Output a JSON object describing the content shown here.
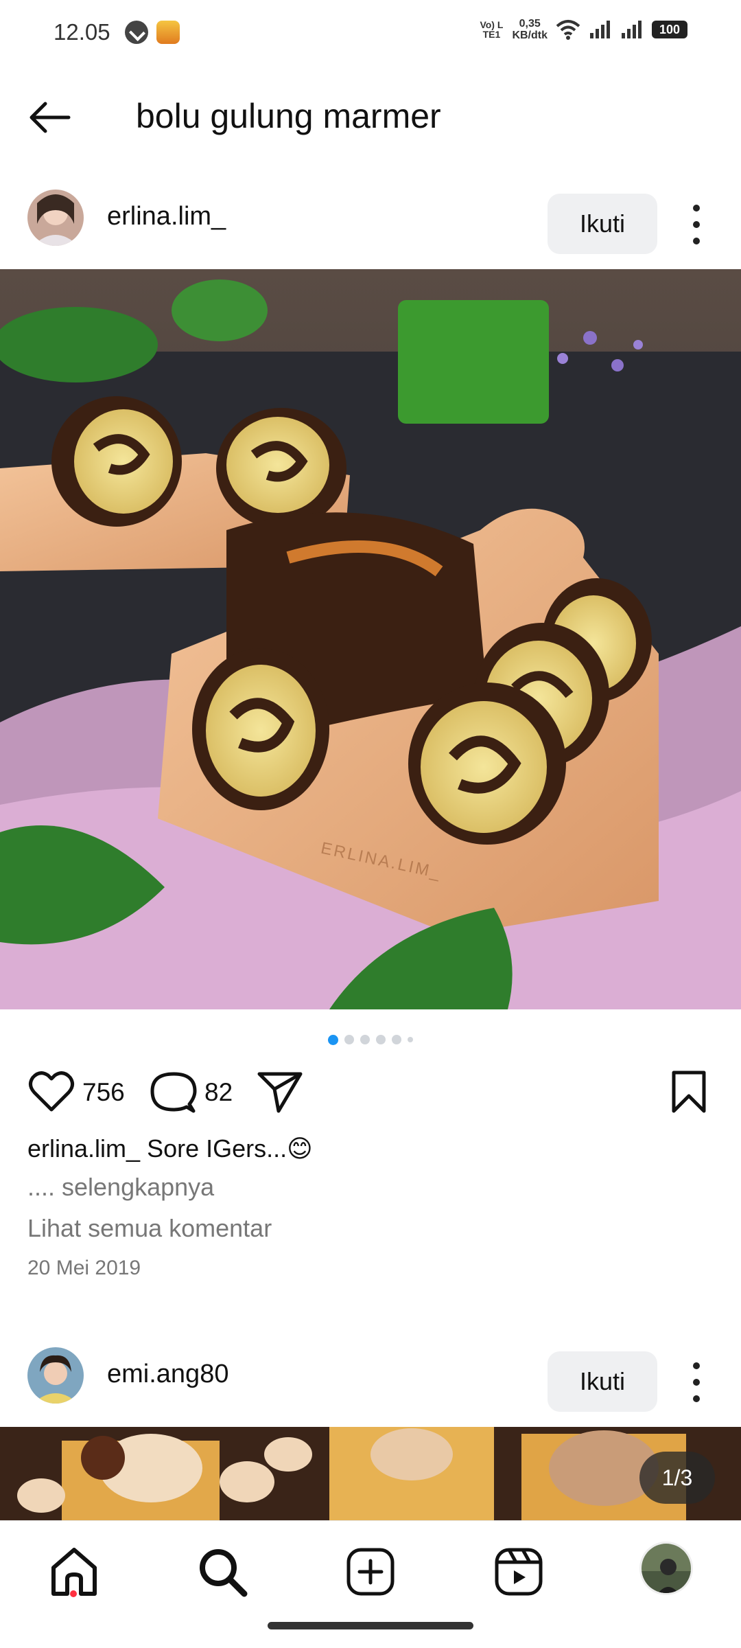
{
  "status_bar": {
    "time": "12.05",
    "volte": "Vo) LTE1",
    "network_speed_value": "0,35",
    "network_speed_unit": "KB/dtk",
    "battery": "100",
    "icons": [
      "compass-icon",
      "app-notification-icon",
      "wifi-icon",
      "signal-icon",
      "signal-icon-2",
      "battery-icon"
    ]
  },
  "header": {
    "title": "bolu gulung marmer",
    "back_icon": "arrow-left-icon"
  },
  "posts": [
    {
      "username": "erlina.lim_",
      "follow_label": "Ikuti",
      "image_watermark": "ERLINA.LIM_",
      "carousel_total_dots": 6,
      "carousel_active_index": 0,
      "likes": "756",
      "comments": "82",
      "caption_user": "erlina.lim_",
      "caption_text": "Sore IGers...😊",
      "more_label": ".... selengkapnya",
      "view_comments_label": "Lihat semua komentar",
      "date": "20 Mei 2019"
    },
    {
      "username": "emi.ang80",
      "follow_label": "Ikuti",
      "page_counter": "1/3"
    }
  ],
  "bottom_nav": {
    "items": [
      "home-icon",
      "search-icon",
      "create-icon",
      "reels-icon",
      "profile-avatar"
    ],
    "active": "home-icon"
  },
  "colors": {
    "accent_blue": "#1a94f3",
    "notification_red": "#ff3040",
    "follow_button_bg": "#eff0f2",
    "secondary_text": "#777777"
  }
}
